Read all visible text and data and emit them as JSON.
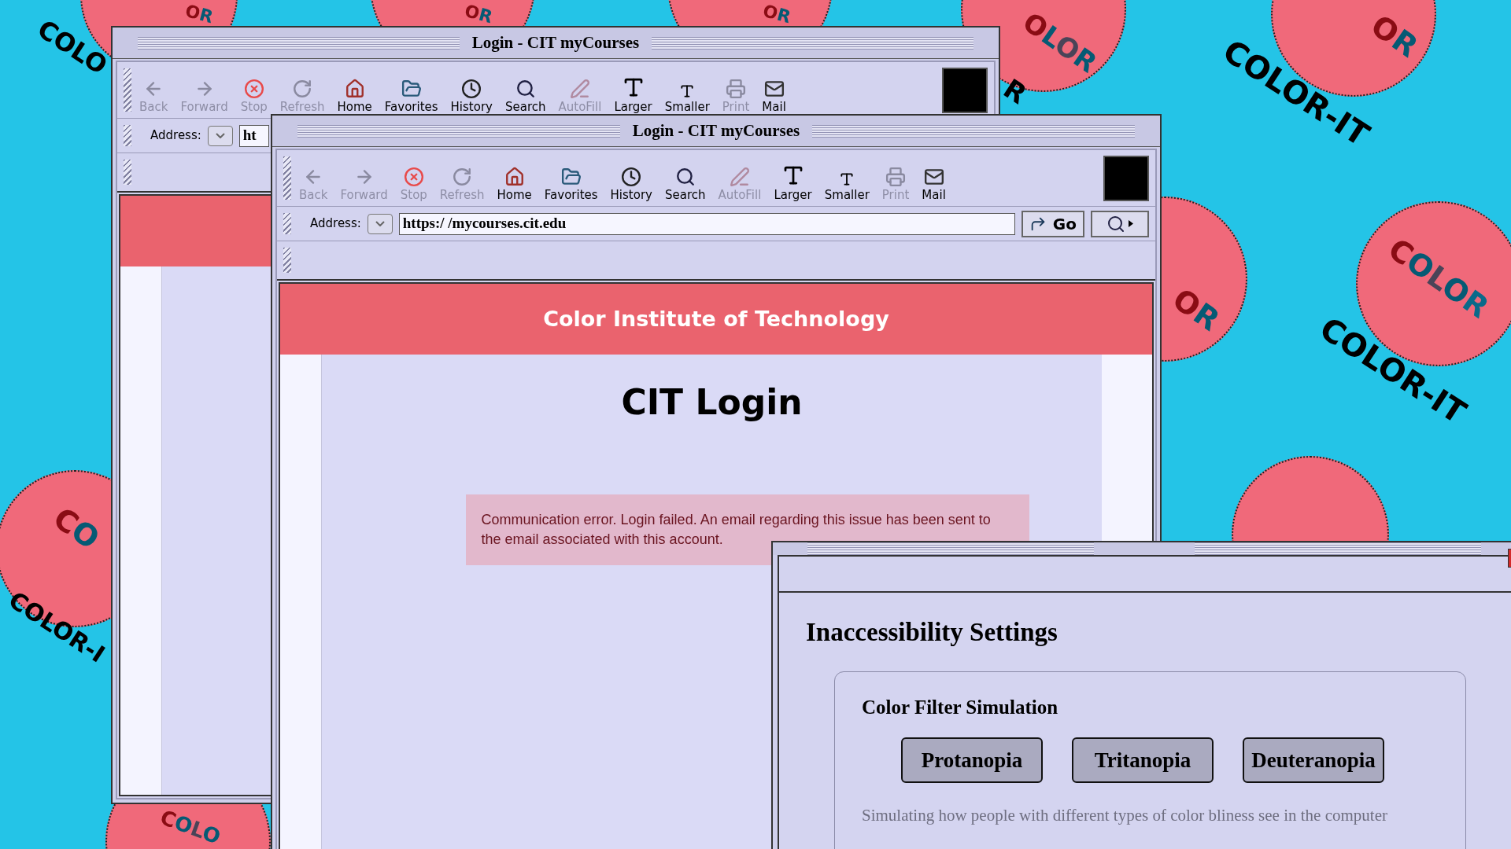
{
  "background": {
    "stickers": [
      {
        "text": "OR"
      },
      {
        "text": "OR"
      },
      {
        "text": "OR"
      },
      {
        "text": "OLOR"
      },
      {
        "text": "OR"
      },
      {
        "text": "OR"
      },
      {
        "text": "COLOR"
      },
      {
        "text": "CO"
      },
      {
        "text": "COLO"
      }
    ],
    "captions": [
      {
        "text": "COLO"
      },
      {
        "text": "COLOR-IT"
      },
      {
        "text": "R"
      },
      {
        "text": "COLOR-IT"
      },
      {
        "text": "COLOR-I"
      }
    ]
  },
  "windows": [
    {
      "title": "Login - CIT myCourses",
      "toolbar": [
        {
          "label": "Back",
          "disabled": true
        },
        {
          "label": "Forward",
          "disabled": true
        },
        {
          "label": "Stop",
          "disabled": true
        },
        {
          "label": "Refresh",
          "disabled": true
        },
        {
          "label": "Home",
          "disabled": false
        },
        {
          "label": "Favorites",
          "disabled": false
        },
        {
          "label": "History",
          "disabled": false
        },
        {
          "label": "Search",
          "disabled": false
        },
        {
          "label": "AutoFill",
          "disabled": true
        },
        {
          "label": "Larger",
          "disabled": false
        },
        {
          "label": "Smaller",
          "disabled": false
        },
        {
          "label": "Print",
          "disabled": true
        },
        {
          "label": "Mail",
          "disabled": false
        }
      ],
      "address": {
        "label": "Address:",
        "value": "ht"
      }
    },
    {
      "title": "Login - CIT myCourses",
      "toolbar": [
        {
          "label": "Back",
          "disabled": true
        },
        {
          "label": "Forward",
          "disabled": true
        },
        {
          "label": "Stop",
          "disabled": true
        },
        {
          "label": "Refresh",
          "disabled": true
        },
        {
          "label": "Home",
          "disabled": false
        },
        {
          "label": "Favorites",
          "disabled": false
        },
        {
          "label": "History",
          "disabled": false
        },
        {
          "label": "Search",
          "disabled": false
        },
        {
          "label": "AutoFill",
          "disabled": true
        },
        {
          "label": "Larger",
          "disabled": false
        },
        {
          "label": "Smaller",
          "disabled": false
        },
        {
          "label": "Print",
          "disabled": true
        },
        {
          "label": "Mail",
          "disabled": false
        }
      ],
      "address": {
        "label": "Address:",
        "value": "https:/ /mycourses.cit.edu"
      },
      "go_button": "Go",
      "page": {
        "site_title": "Color Institute of Technology",
        "heading": "CIT Login",
        "error": "Communication error. Login failed. An email regarding this issue has been sent to the email associated with this account."
      }
    }
  ],
  "settings": {
    "heading": "Inaccessibility Settings",
    "section": {
      "title": "Color Filter Simulation",
      "buttons": [
        {
          "label": "Protanopia"
        },
        {
          "label": "Tritanopia"
        },
        {
          "label": "Deuteranopia"
        }
      ],
      "description": "Simulating how people with different types of color bliness see in the computer"
    }
  }
}
